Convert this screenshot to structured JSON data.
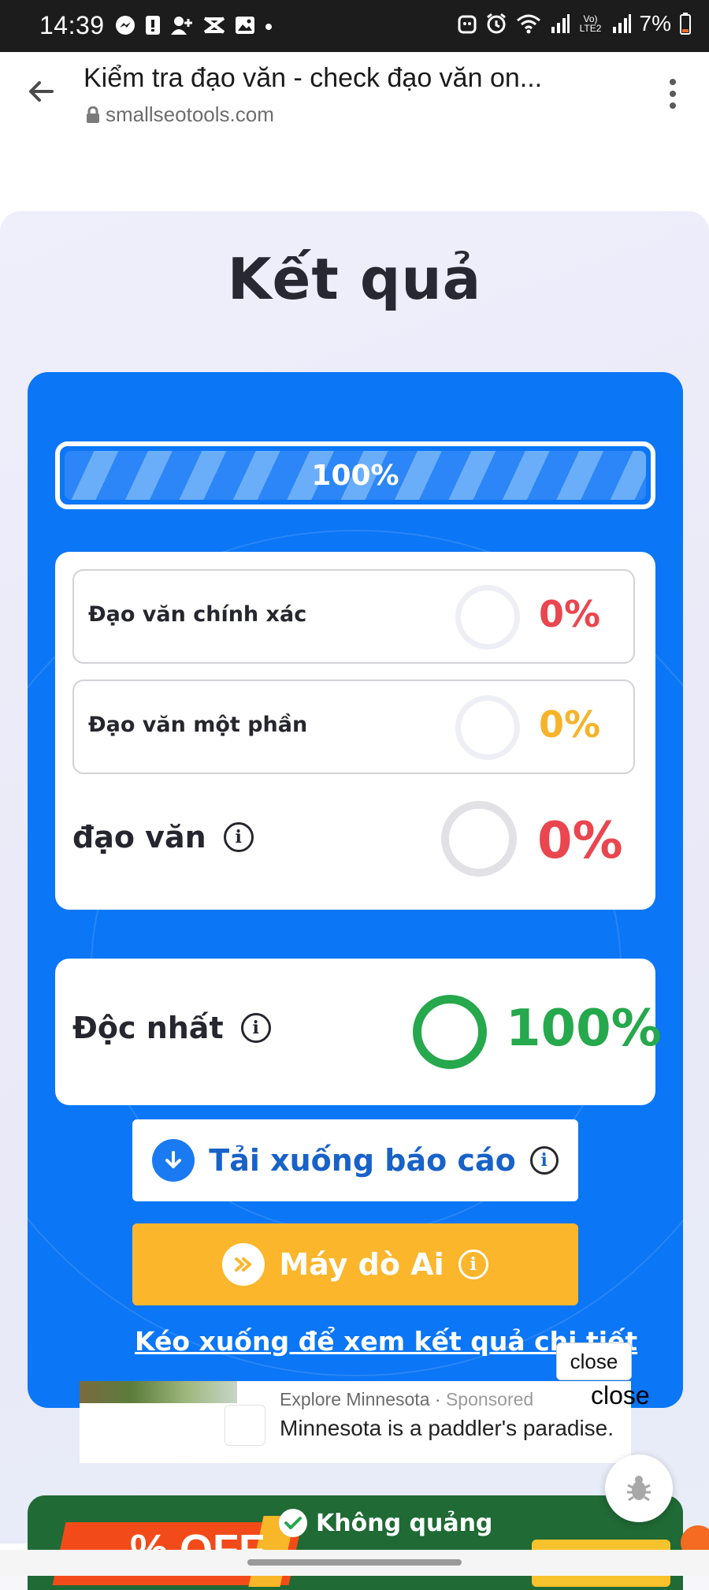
{
  "status_bar": {
    "time": "14:39",
    "battery": "7%",
    "network_label": "Vo) LTE2"
  },
  "browser": {
    "page_title": "Kiểm tra đạo văn - check đạo văn on...",
    "domain": "smallseotools.com"
  },
  "results": {
    "heading": "Kết quả",
    "progress_label": "100%",
    "progress_value": 100,
    "rows": [
      {
        "label": "Đạo văn chính xác",
        "value": "0%",
        "color": "#ea4650"
      },
      {
        "label": "Đạo văn một phần",
        "value": "0%",
        "color": "#f6b32a"
      }
    ],
    "plagiarism": {
      "label": "đạo văn",
      "value": "0%",
      "color": "#ea4650"
    },
    "unique": {
      "label": "Độc nhất",
      "value": "100%",
      "color": "#26a84c"
    },
    "download_button": "Tải xuống báo cáo",
    "ai_button": "Máy dò Ai",
    "scroll_link": "Kéo xuống để xem kết quả chi tiết"
  },
  "ad": {
    "source": "Explore Minnesota",
    "sponsored": "Sponsored",
    "text": "Minnesota is a paddler's paradise.",
    "close_label": "close",
    "close_label_2": "close"
  },
  "promo": {
    "discount_text": "% OFF",
    "text": "Không quảng"
  },
  "colors": {
    "primary_blue": "#0b76f6",
    "accent_orange": "#fbb62c",
    "success_green": "#26a84c",
    "danger_red": "#ea4650"
  }
}
